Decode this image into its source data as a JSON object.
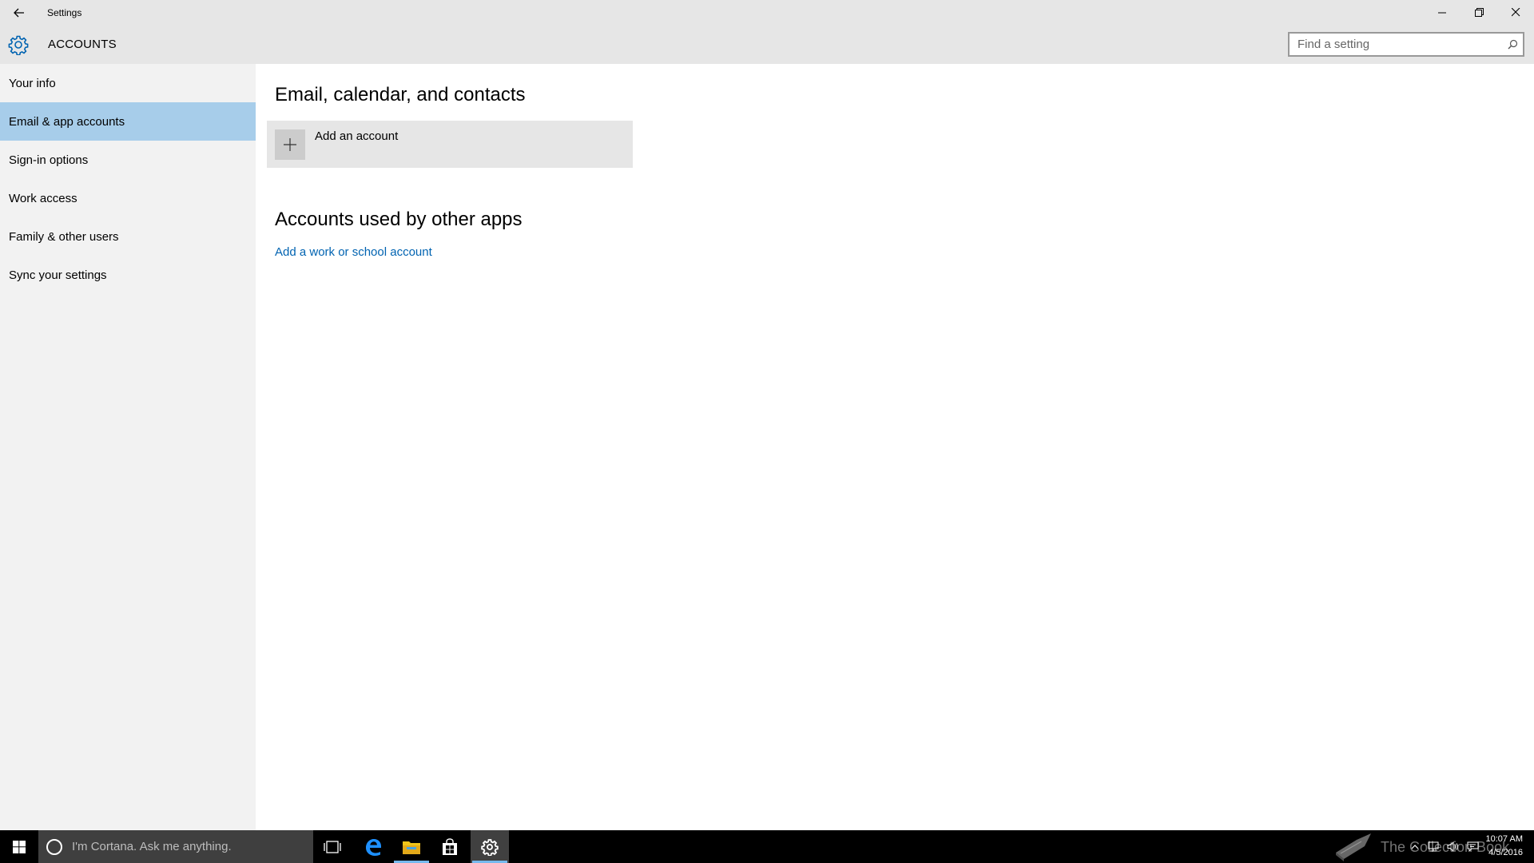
{
  "window": {
    "title": "Settings",
    "controls": [
      "minimize",
      "restore",
      "close"
    ]
  },
  "header": {
    "section_title": "ACCOUNTS",
    "search_placeholder": "Find a setting"
  },
  "sidebar": {
    "items": [
      {
        "label": "Your info",
        "active": false
      },
      {
        "label": "Email & app accounts",
        "active": true
      },
      {
        "label": "Sign-in options",
        "active": false
      },
      {
        "label": "Work access",
        "active": false
      },
      {
        "label": "Family & other users",
        "active": false
      },
      {
        "label": "Sync your settings",
        "active": false
      }
    ]
  },
  "main": {
    "section1_title": "Email, calendar, and contacts",
    "add_account_label": "Add an account",
    "section2_title": "Accounts used by other apps",
    "add_work_link": "Add a work or school account"
  },
  "taskbar": {
    "cortana_placeholder": "I'm Cortana. Ask me anything.",
    "watermark": "The Collection Book",
    "time": "10:07 AM",
    "date": "4/5/2016"
  },
  "colors": {
    "accent": "#0063b1",
    "selected_nav": "#a7cdea",
    "chrome": "#e6e6e6",
    "sidebar": "#f2f2f2",
    "taskbar": "#000000"
  }
}
